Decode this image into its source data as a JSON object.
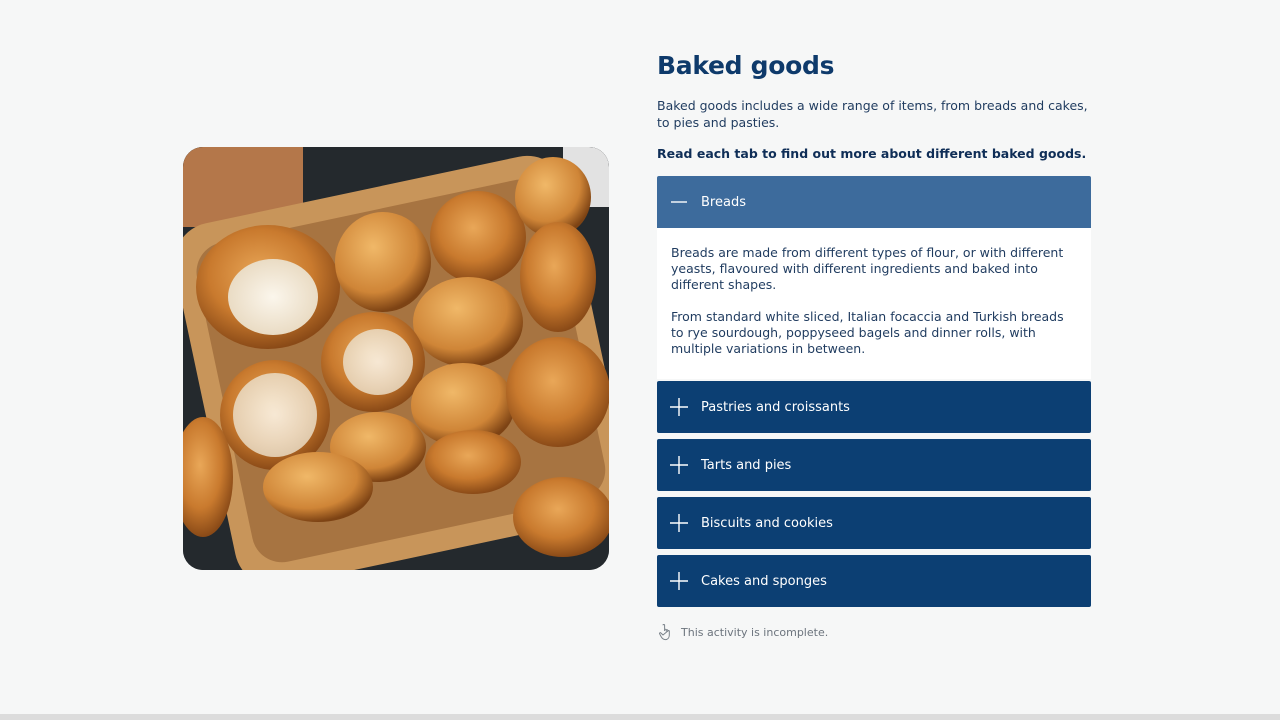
{
  "title": "Baked goods",
  "intro": "Baked goods includes a wide range of items, from breads and cakes, to pies and pasties.",
  "instruction": "Read each tab to find out more about different baked goods.",
  "image": {
    "icon": "bakery-basket-photo"
  },
  "accordion": {
    "items": [
      {
        "label": "Breads",
        "open": true,
        "paragraphs": [
          "Breads are made from different types of flour, or with different yeasts, flavoured with different ingredients and baked into different shapes.",
          "From standard white sliced, Italian focaccia and Turkish breads to rye sourdough, poppyseed bagels and dinner rolls, with multiple variations in between."
        ]
      },
      {
        "label": "Pastries and croissants",
        "open": false
      },
      {
        "label": "Tarts and pies",
        "open": false
      },
      {
        "label": "Biscuits and cookies",
        "open": false
      },
      {
        "label": "Cakes and sponges",
        "open": false
      }
    ]
  },
  "status": {
    "text": "This activity is incomplete.",
    "icon": "hand-pointer-icon"
  },
  "colors": {
    "primary": "#0c3f73",
    "active_header": "#3d6b9c",
    "title": "#0e3a6b",
    "background": "#f6f7f7"
  }
}
